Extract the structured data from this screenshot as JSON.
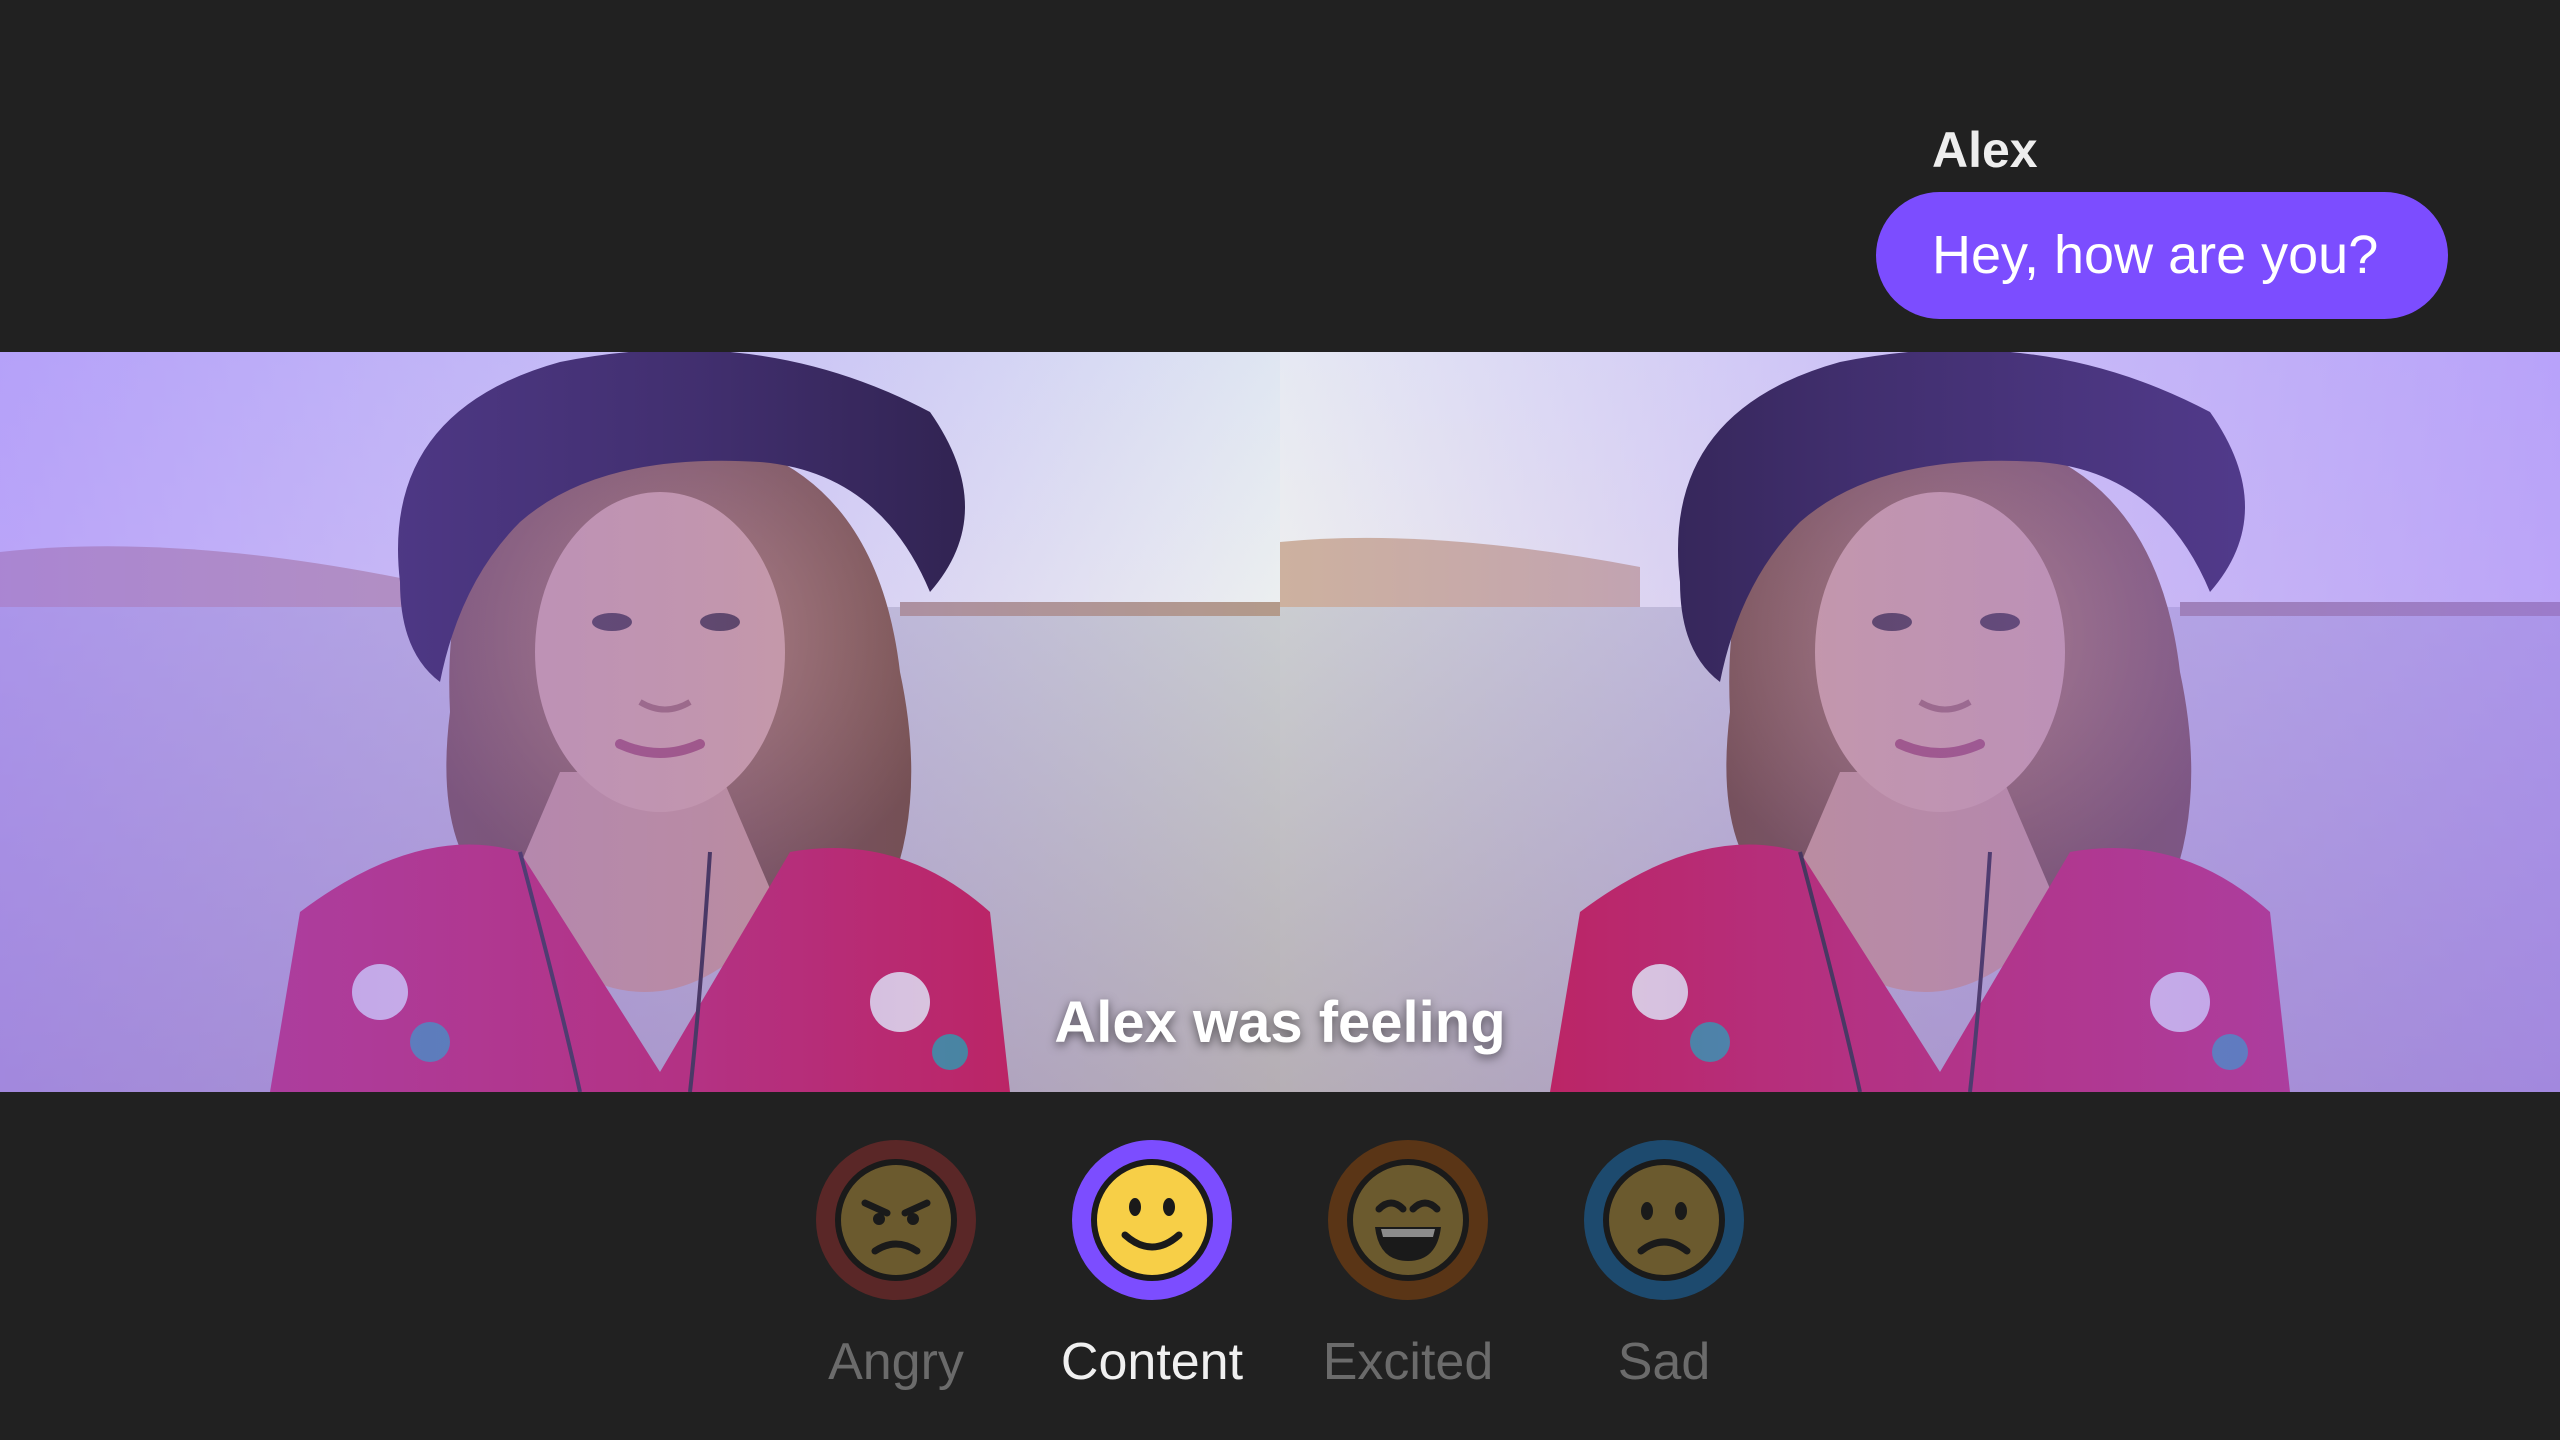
{
  "chat": {
    "sender": "Alex",
    "message": "Hey, how are you?"
  },
  "prompt": "Alex was feeling",
  "moods": [
    {
      "label": "Angry",
      "icon": "angry-face-icon",
      "selected": false,
      "ring_color": "#5a2727"
    },
    {
      "label": "Content",
      "icon": "smiling-face-icon",
      "selected": true,
      "ring_color": "#7c4dff"
    },
    {
      "label": "Excited",
      "icon": "grinning-face-icon",
      "selected": false,
      "ring_color": "#5a3516"
    },
    {
      "label": "Sad",
      "icon": "frowning-face-icon",
      "selected": false,
      "ring_color": "#1d4a6e"
    }
  ],
  "colors": {
    "background": "#212121",
    "accent": "#7c4dff",
    "label_inactive": "#6b6b6b",
    "label_active": "#f0f0f0"
  }
}
